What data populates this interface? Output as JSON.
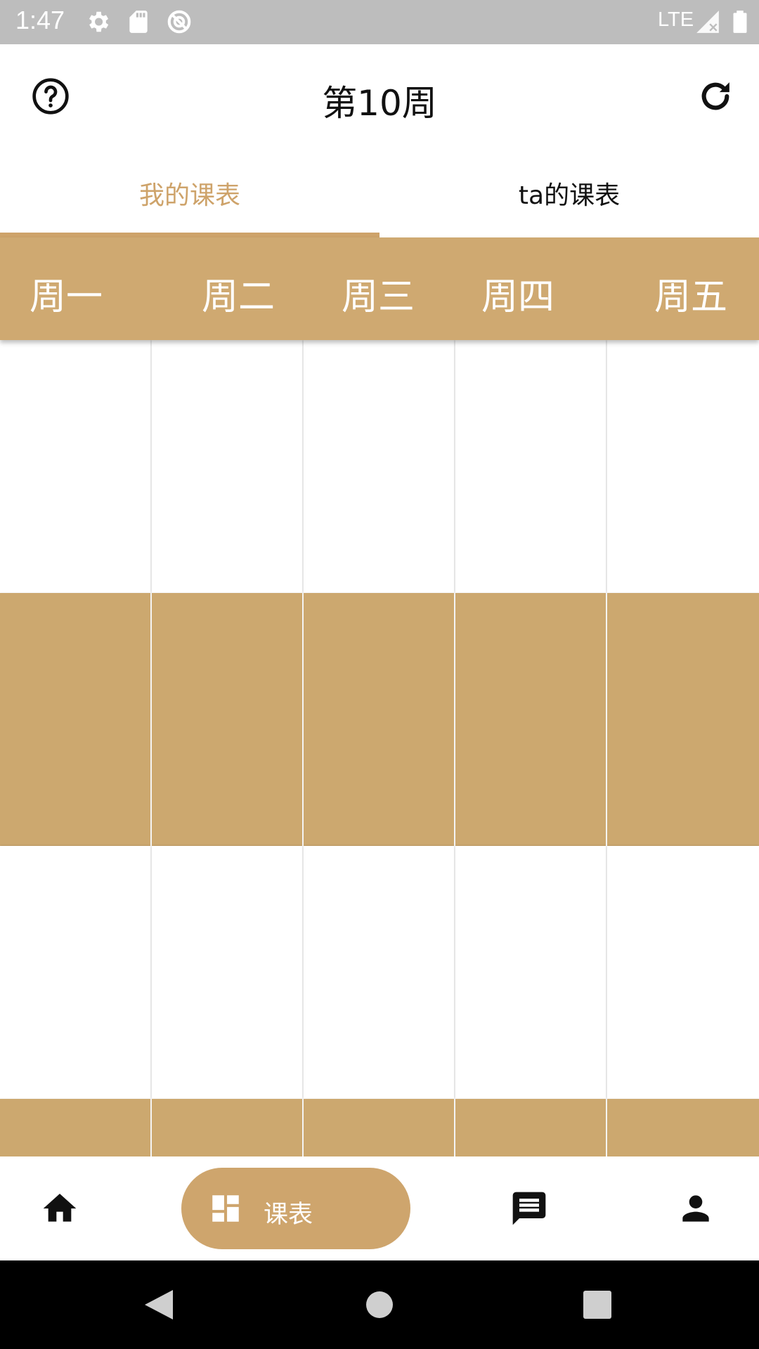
{
  "status_bar": {
    "time": "1:47",
    "network": "LTE",
    "icons": [
      "settings-icon",
      "sd-card-icon",
      "vpn-icon",
      "signal-icon",
      "battery-icon"
    ]
  },
  "app_bar": {
    "title": "第10周",
    "left_icon": "help-icon",
    "right_icon": "refresh-icon"
  },
  "tabs": [
    {
      "label": "我的课表",
      "selected": true
    },
    {
      "label": "ta的课表",
      "selected": false
    }
  ],
  "weekdays": [
    "周一",
    "周二",
    "周三",
    "周四",
    "周五"
  ],
  "timetable": {
    "rows": [
      "empty",
      "filled",
      "empty",
      "filled"
    ]
  },
  "bottom_nav": {
    "items": [
      {
        "icon": "home-icon"
      },
      {
        "icon": "dashboard-icon",
        "label": "课表",
        "active": true
      },
      {
        "icon": "message-icon"
      },
      {
        "icon": "person-icon"
      }
    ]
  },
  "colors": {
    "accent": "#cea36a",
    "header_bg": "#cfa971",
    "filled_cell": "#cca86f",
    "status_bar_bg": "#bdbdbd"
  }
}
